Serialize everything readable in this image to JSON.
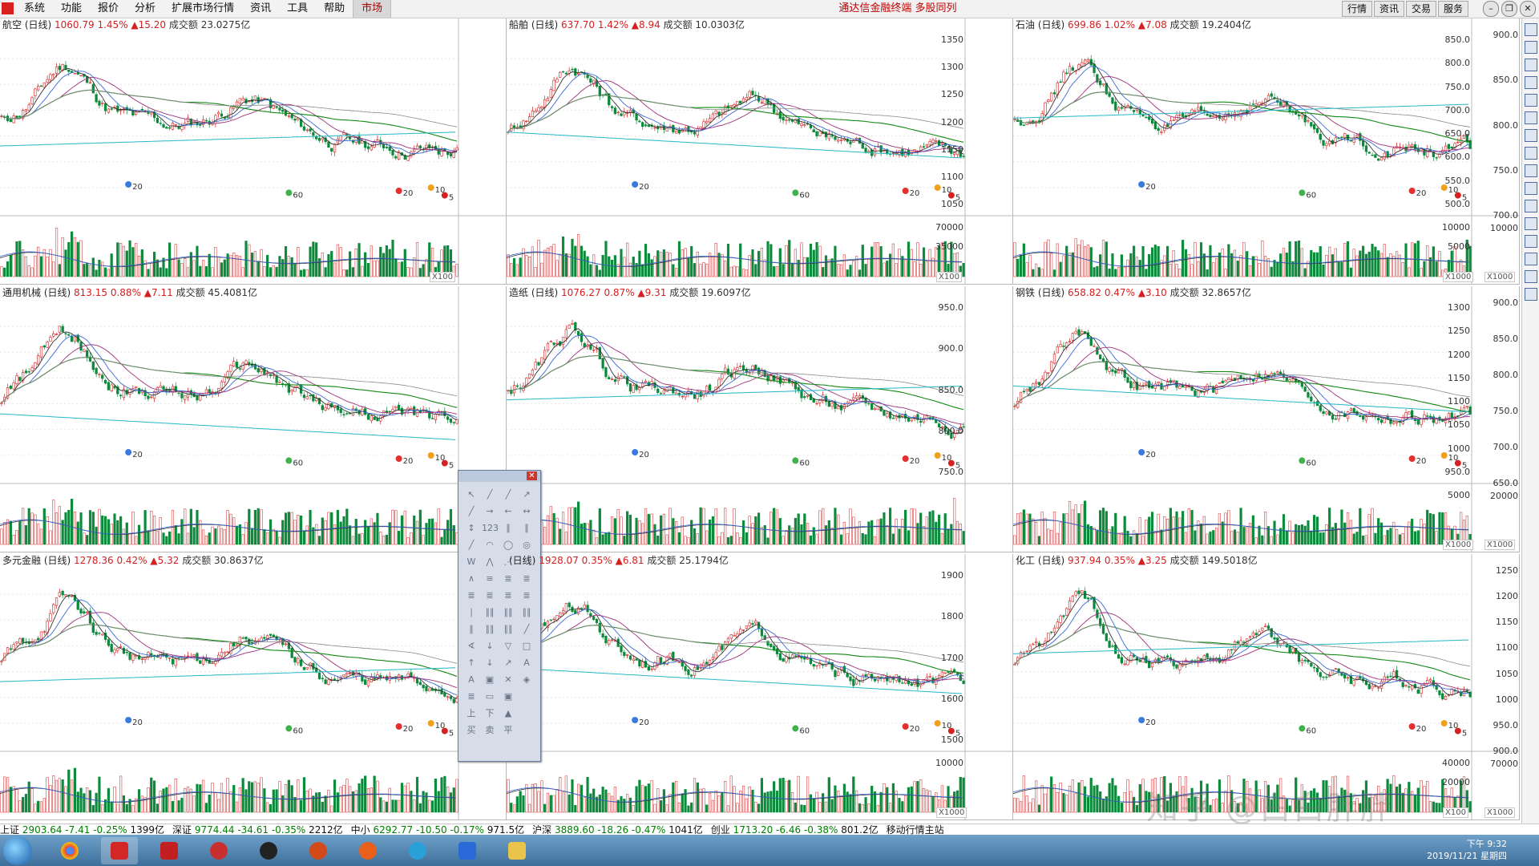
{
  "menu": {
    "items": [
      "系统",
      "功能",
      "报价",
      "分析",
      "扩展市场行情",
      "资讯",
      "工具",
      "帮助",
      "市场"
    ],
    "title": "通达信金融终端 多股同列",
    "right_buttons": [
      "行情",
      "资讯",
      "交易",
      "服务"
    ]
  },
  "panels": [
    {
      "title": "航空 (日线)",
      "price": "1060.79",
      "pct": "1.45%",
      "chg": "▲15.20",
      "turnover_label": "成交额",
      "turnover": "23.0275亿",
      "price_ticks": [],
      "vol_ticks": [],
      "mult": "X100",
      "labels": [
        "20",
        "60",
        "20",
        "10",
        "5"
      ]
    },
    {
      "title": "船舶 (日线)",
      "price": "637.70",
      "pct": "1.42%",
      "chg": "▲8.94",
      "turnover_label": "成交额",
      "turnover": "10.0303亿",
      "price_ticks": [
        "1350",
        "1300",
        "1250",
        "1200",
        "1150",
        "1100",
        "1050"
      ],
      "vol_ticks": [
        "70000",
        "35000"
      ],
      "mult": "X100",
      "labels": [
        "20",
        "60",
        "20",
        "10",
        "5"
      ]
    },
    {
      "title": "石油 (日线)",
      "price": "699.86",
      "pct": "1.02%",
      "chg": "▲7.08",
      "turnover_label": "成交额",
      "turnover": "19.2404亿",
      "price_ticks": [
        "850.0",
        "800.0",
        "750.0",
        "700.0",
        "650.0",
        "600.0",
        "550.0",
        "500.0"
      ],
      "vol_ticks": [
        "10000",
        "5000"
      ],
      "mult": "X1000",
      "labels": [
        "20",
        "60",
        "20",
        "10",
        "5"
      ]
    },
    {
      "title": "通用机械 (日线)",
      "price": "813.15",
      "pct": "0.88%",
      "chg": "▲7.11",
      "turnover_label": "成交额",
      "turnover": "45.4081亿",
      "price_ticks": [],
      "vol_ticks": [],
      "mult": "",
      "labels": [
        "20",
        "60",
        "20",
        "10",
        "5"
      ]
    },
    {
      "title": "造纸 (日线)",
      "price": "1076.27",
      "pct": "0.87%",
      "chg": "▲9.31",
      "turnover_label": "成交额",
      "turnover": "19.6097亿",
      "price_ticks": [
        "950.0",
        "900.0",
        "850.0",
        "800.0",
        "750.0"
      ],
      "vol_ticks": [],
      "mult": "",
      "labels": [
        "20",
        "60",
        "20",
        "10",
        "5"
      ]
    },
    {
      "title": "钢铁 (日线)",
      "price": "658.82",
      "pct": "0.47%",
      "chg": "▲3.10",
      "turnover_label": "成交额",
      "turnover": "32.8657亿",
      "price_ticks": [
        "1300",
        "1250",
        "1200",
        "1150",
        "1100",
        "1050",
        "1000",
        "950.0"
      ],
      "vol_ticks": [
        "5000"
      ],
      "mult": "X1000",
      "labels": [
        "20",
        "60",
        "20",
        "10",
        "5"
      ]
    },
    {
      "title": "多元金融 (日线)",
      "price": "1278.36",
      "pct": "0.42%",
      "chg": "▲5.32",
      "turnover_label": "成交额",
      "turnover": "30.8637亿",
      "price_ticks": [],
      "vol_ticks": [],
      "mult": "",
      "labels": [
        "20",
        "60",
        "20",
        "10",
        "5"
      ]
    },
    {
      "title": "(日线)",
      "price": "1928.07",
      "pct": "0.35%",
      "chg": "▲6.81",
      "turnover_label": "成交额",
      "turnover": "25.1794亿",
      "price_ticks": [
        "1900",
        "1800",
        "1700",
        "1600",
        "1500"
      ],
      "vol_ticks": [
        "10000"
      ],
      "mult": "X1000",
      "labels": [
        "20",
        "60",
        "20",
        "10",
        "5"
      ]
    },
    {
      "title": "化工 (日线)",
      "price": "937.94",
      "pct": "0.35%",
      "chg": "▲3.25",
      "turnover_label": "成交额",
      "turnover": "149.5018亿",
      "price_ticks": [],
      "vol_ticks": [
        "40000",
        "20000"
      ],
      "mult": "X100",
      "labels": [
        "20",
        "60",
        "20",
        "10",
        "5"
      ]
    }
  ],
  "right_axes": {
    "top": {
      "price_ticks": [
        "900.0",
        "850.0",
        "800.0",
        "750.0",
        "700.0"
      ],
      "vol_ticks": [
        "10000"
      ],
      "mult": "X1000"
    },
    "mid": {
      "price_ticks": [
        "900.0",
        "850.0",
        "800.0",
        "750.0",
        "700.0",
        "650.0"
      ],
      "vol_ticks": [
        "20000"
      ],
      "mult": "X1000"
    },
    "bot": {
      "price_ticks": [
        "1250",
        "1200",
        "1150",
        "1100",
        "1050",
        "1000",
        "950.0",
        "900.0"
      ],
      "vol_ticks": [
        "70000"
      ],
      "mult": "X1000"
    }
  },
  "statusbar": [
    {
      "name": "上证",
      "value": "2903.64",
      "chg": "-7.41",
      "pct": "-0.25%",
      "amt": "1399亿"
    },
    {
      "name": "深证",
      "value": "9774.44",
      "chg": "-34.61",
      "pct": "-0.35%",
      "amt": "2212亿"
    },
    {
      "name": "中小",
      "value": "6292.77",
      "chg": "-10.50",
      "pct": "-0.17%",
      "amt": "971.5亿"
    },
    {
      "name": "沪深",
      "value": "3889.60",
      "chg": "-18.26",
      "pct": "-0.47%",
      "amt": "1041亿"
    },
    {
      "name": "创业",
      "value": "1713.20",
      "chg": "-6.46",
      "pct": "-0.38%",
      "amt": "801.2亿"
    }
  ],
  "status_right": "移动行情主站",
  "watermark": "知乎 @白白胖胖",
  "taskbar": {
    "time": "下午 9:32",
    "date": "2019/11/21 星期四"
  },
  "toolbox": {
    "tools": [
      "↖",
      "╱",
      "╱",
      "↗",
      "╱",
      "→",
      "←",
      "↔",
      "↕",
      "123",
      "∥",
      "∥",
      "╱",
      "◠",
      "◯",
      "◎",
      "W",
      "⋀",
      "⋰",
      "⋱",
      "∧",
      "≡",
      "≣",
      "≣",
      "≣",
      "≣",
      "≣",
      "≣",
      "∣",
      "∥∥",
      "∥∥",
      "∥∥",
      "∥",
      "∥∥",
      "∥∥",
      "╱",
      "∢",
      "↓",
      "▽",
      "□",
      "↑",
      "↓",
      "↗",
      "A",
      "A",
      "▣",
      "✕",
      "◈",
      "≣",
      "▭",
      "▣",
      "",
      "上",
      "下",
      "▲",
      "",
      "买",
      "卖",
      "平",
      ""
    ]
  },
  "colors": {
    "up": "#d42020",
    "down": "#0a8a3a",
    "ma5": "#333333",
    "ma10": "#3a6ad8",
    "ma20": "#a0307a",
    "ma60": "#118811",
    "ma120": "#8a8a8a",
    "ma250": "#22b8c8"
  }
}
